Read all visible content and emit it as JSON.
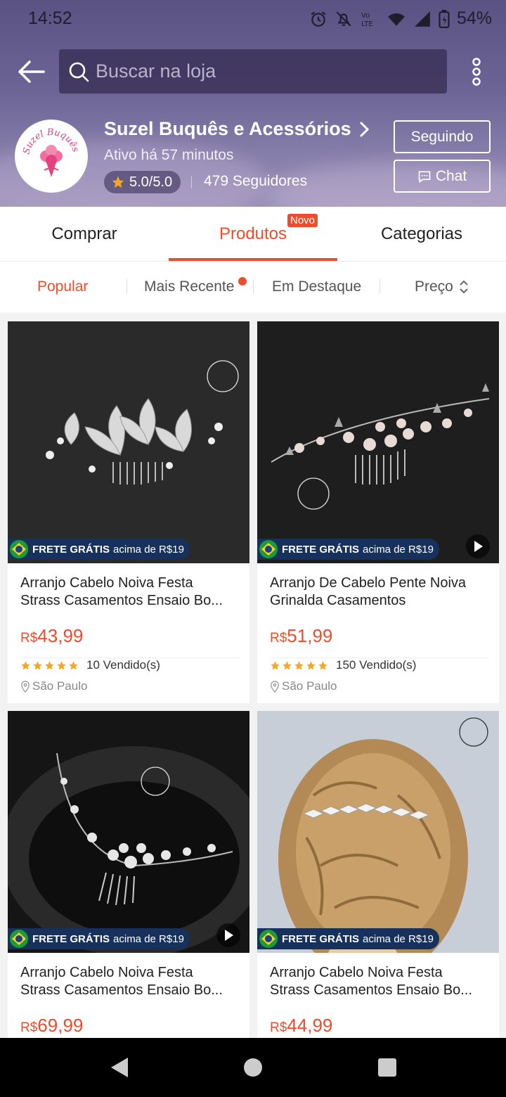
{
  "status": {
    "time": "14:52",
    "battery": "54%"
  },
  "search": {
    "placeholder": "Buscar na loja"
  },
  "shop": {
    "name": "Suzel Buquês e Acessórios",
    "logo_text": "Suzel Buquês",
    "active": "Ativo há 57 minutos",
    "rating": "5.0/5.0",
    "followers": "479 Seguidores",
    "following_label": "Seguindo",
    "chat_label": "Chat"
  },
  "tabs": [
    {
      "label": "Comprar"
    },
    {
      "label": "Produtos",
      "badge": "Novo"
    },
    {
      "label": "Categorias"
    }
  ],
  "sort": [
    {
      "label": "Popular"
    },
    {
      "label": "Mais Recente"
    },
    {
      "label": "Em Destaque"
    },
    {
      "label": "Preço"
    }
  ],
  "badge": {
    "label": "FRETE GRÁTIS",
    "amount": "acima de R$19"
  },
  "products": [
    {
      "title1": "Arranjo Cabelo Noiva Festa",
      "title2": "Strass Casamentos Ensaio Bo...",
      "currency": "R$",
      "price": "43,99",
      "sold": "10 Vendido(s)",
      "location": "São Paulo"
    },
    {
      "title1": "Arranjo De Cabelo Pente Noiva",
      "title2": "Grinalda Casamentos",
      "currency": "R$",
      "price": "51,99",
      "sold": "150 Vendido(s)",
      "location": "São Paulo"
    },
    {
      "title1": "Arranjo Cabelo Noiva Festa",
      "title2": "Strass Casamentos Ensaio Bo...",
      "currency": "R$",
      "price": "69,99"
    },
    {
      "title1": "Arranjo Cabelo Noiva Festa",
      "title2": "Strass Casamentos Ensaio Bo...",
      "currency": "R$",
      "price": "44,99"
    }
  ],
  "colors": {
    "accent": "#ee4d2d",
    "header": "#6d6596",
    "badge_bg": "#16325c",
    "star": "#f5a623"
  }
}
